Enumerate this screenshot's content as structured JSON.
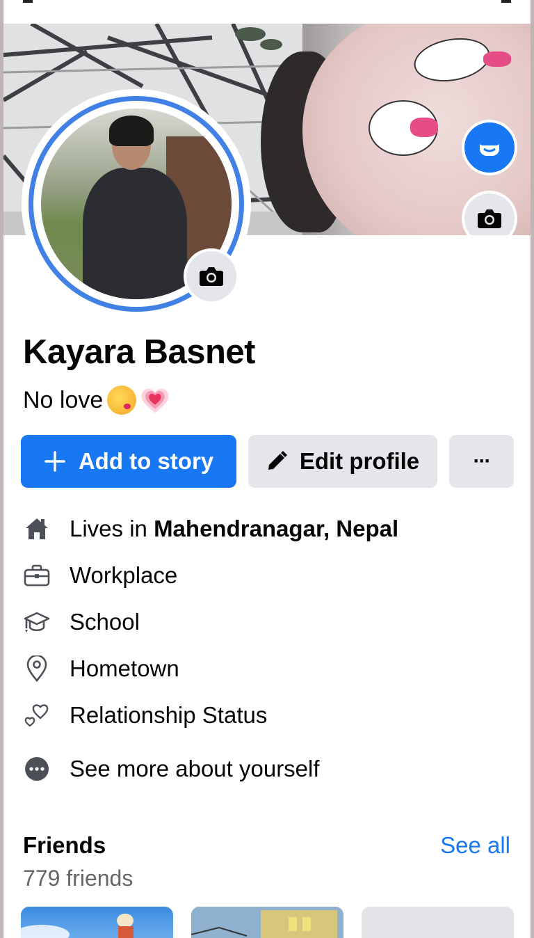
{
  "profile": {
    "name": "Kayara Basnet",
    "bio_text": "No love",
    "bio_emojis": [
      "face-blowing-kiss-emoji",
      "growing-heart-emoji"
    ]
  },
  "actions": {
    "add_story_label": "Add to story",
    "edit_profile_label": "Edit profile",
    "more_label": "···"
  },
  "details": [
    {
      "icon": "house-icon",
      "prefix": "Lives in ",
      "value": "Mahendranagar, Nepal"
    },
    {
      "icon": "briefcase-icon",
      "prefix": "Workplace",
      "value": ""
    },
    {
      "icon": "graduation-cap-icon",
      "prefix": "School",
      "value": ""
    },
    {
      "icon": "location-pin-icon",
      "prefix": "Hometown",
      "value": ""
    },
    {
      "icon": "hearts-icon",
      "prefix": "Relationship Status",
      "value": ""
    },
    {
      "icon": "more-dots-icon",
      "prefix": "See more about yourself",
      "value": ""
    }
  ],
  "friends": {
    "title": "Friends",
    "count": "779 friends",
    "see_all": "See all"
  },
  "colors": {
    "accent": "#1877f2",
    "ring": "#4181e6",
    "button_gray": "#e4e6eb",
    "secondary_text": "#65676b"
  }
}
